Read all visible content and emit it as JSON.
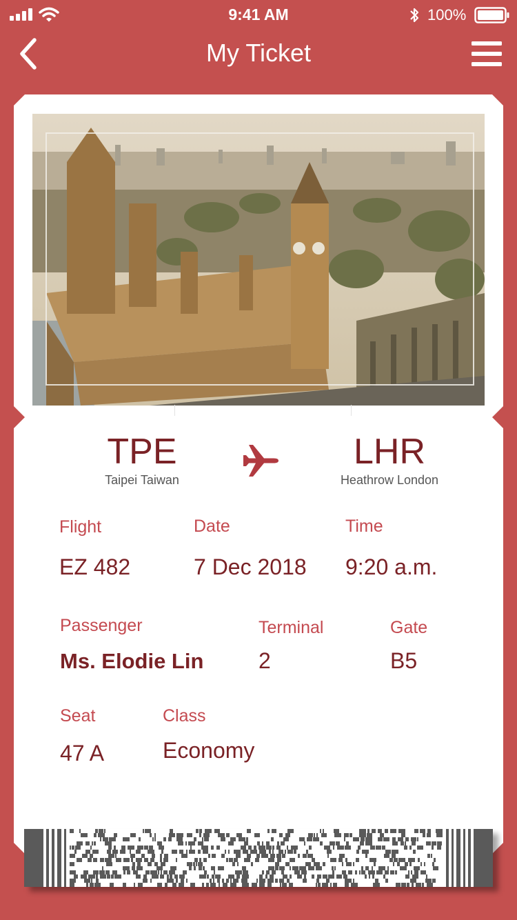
{
  "status_bar": {
    "time": "9:41 AM",
    "battery_text": "100%",
    "icons": [
      "signal-icon",
      "wifi-icon",
      "bluetooth-icon",
      "battery-icon"
    ]
  },
  "nav": {
    "title": "My Ticket",
    "back_icon": "chevron-left-icon",
    "menu_icon": "hamburger-menu-icon"
  },
  "route": {
    "origin_code": "TPE",
    "origin_city": "Taipei Taiwan",
    "destination_code": "LHR",
    "destination_city": "Heathrow London",
    "icon": "airplane-icon"
  },
  "details": {
    "flight_label": "Flight",
    "flight_value": "EZ 482",
    "date_label": "Date",
    "date_value": "7 Dec 2018",
    "time_label": "Time",
    "time_value": "9:20 a.m.",
    "passenger_label": "Passenger",
    "passenger_value": "Ms. Elodie Lin",
    "terminal_label": "Terminal",
    "terminal_value": "2",
    "gate_label": "Gate",
    "gate_value": "B5",
    "seat_label": "Seat",
    "seat_value": "47 A",
    "class_label": "Class",
    "class_value": "Economy"
  },
  "colors": {
    "background": "#c4504f",
    "accent_dark": "#7a2226",
    "label": "#c44a50",
    "card": "#ffffff"
  }
}
